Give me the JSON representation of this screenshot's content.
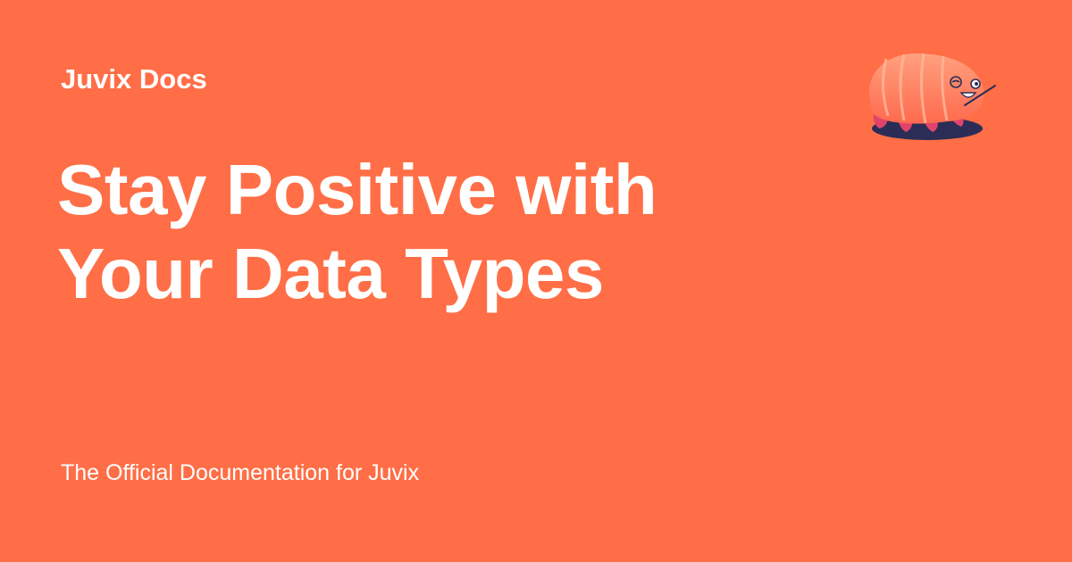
{
  "site": {
    "name": "Juvix Docs"
  },
  "page": {
    "title_lines": [
      "Stay Positive with",
      "Your Data Types"
    ],
    "description": "The Official Documentation for Juvix"
  },
  "logo": {
    "icon": "juvix-tardigrade-mascot-icon"
  },
  "colors": {
    "background": "#FF6E46",
    "text": "#FFFFFF",
    "mascot_body": "#FF8A62",
    "mascot_shadow": "#2B2D57",
    "mascot_legs": "#E0446A"
  }
}
